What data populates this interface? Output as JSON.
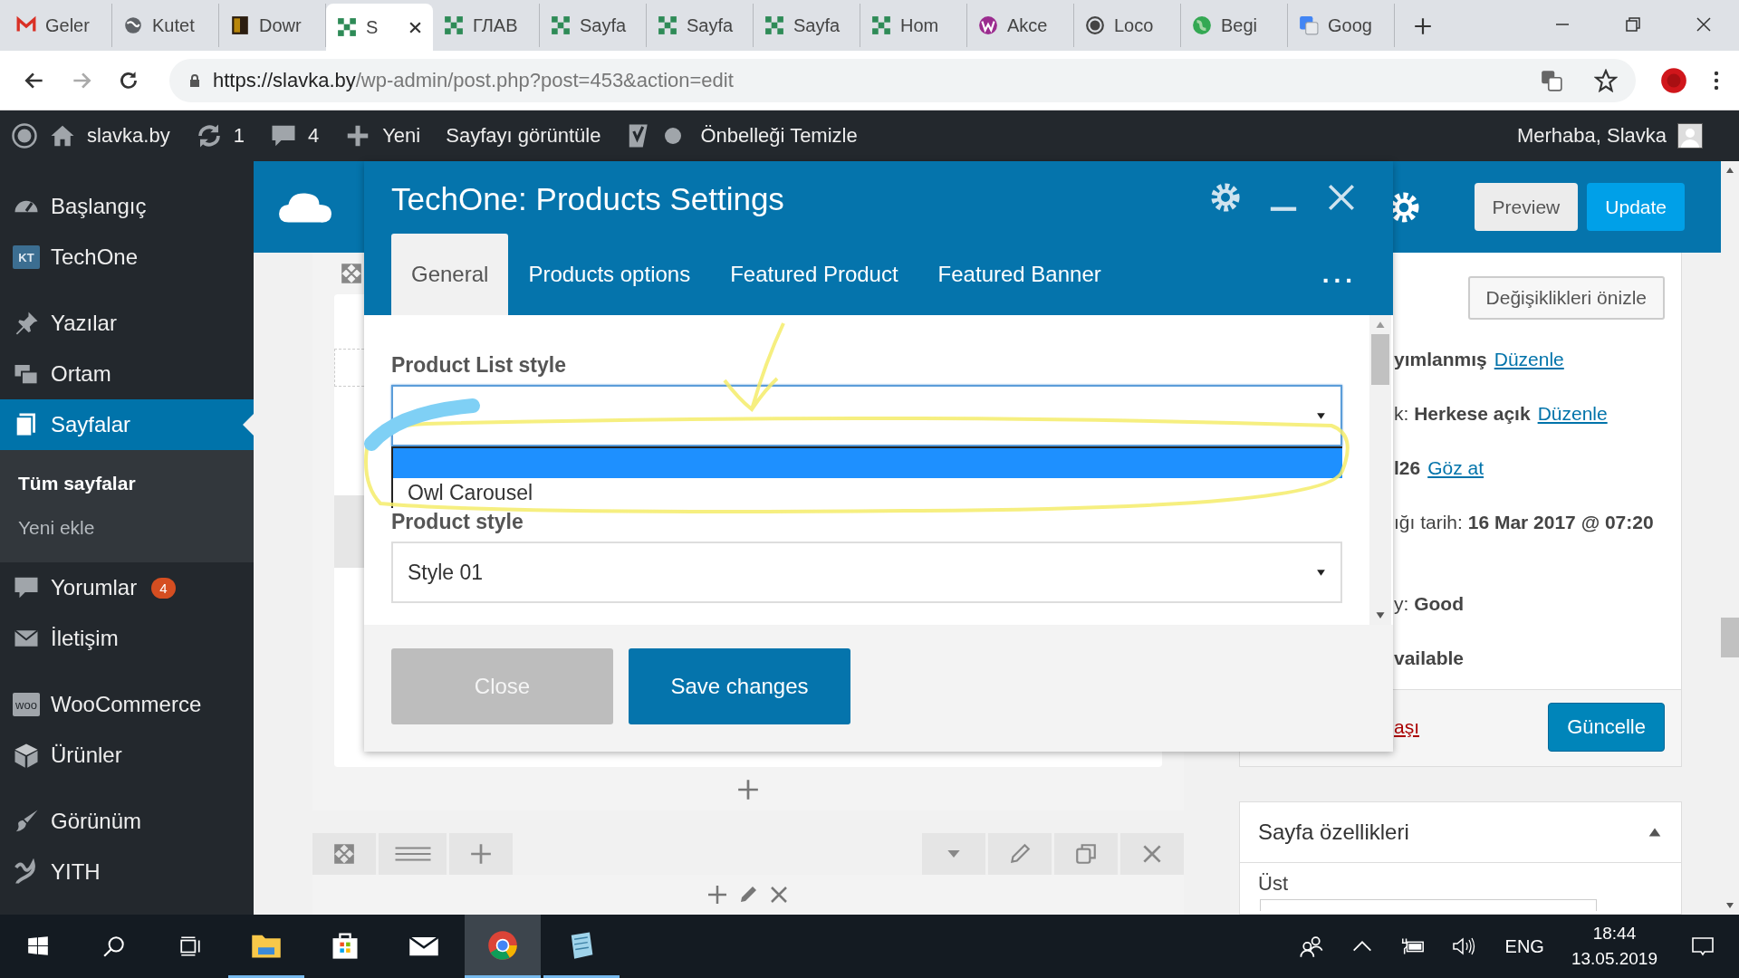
{
  "browser": {
    "tabs": [
      {
        "label": "Geler",
        "kind": "gmail",
        "selected": false
      },
      {
        "label": "Kutet",
        "kind": "globe",
        "selected": false
      },
      {
        "label": "Dowr",
        "kind": "book",
        "selected": false
      },
      {
        "label": "S",
        "kind": "grid",
        "selected": true
      },
      {
        "label": "ГЛАВ",
        "kind": "grid",
        "selected": false
      },
      {
        "label": "Sayfa",
        "kind": "grid",
        "selected": false
      },
      {
        "label": "Sayfa",
        "kind": "grid",
        "selected": false
      },
      {
        "label": "Sayfa",
        "kind": "grid",
        "selected": false
      },
      {
        "label": "Hom",
        "kind": "grid",
        "selected": false
      },
      {
        "label": "Akce",
        "kind": "w",
        "selected": false
      },
      {
        "label": "Loco",
        "kind": "wordpress",
        "selected": false
      },
      {
        "label": "Begi",
        "kind": "earth",
        "selected": false
      },
      {
        "label": "Goog",
        "kind": "translate",
        "selected": false
      }
    ],
    "url_host": "https://slavka.by",
    "url_path": "/wp-admin/post.php?post=453&action=edit"
  },
  "admin_bar": {
    "site": "slavka.by",
    "updates": "1",
    "comments": "4",
    "new": "Yeni",
    "view": "Sayfayı görüntüle",
    "cache": "Önbelleği Temizle",
    "greeting": "Merhaba, Slavka"
  },
  "sidebar": {
    "groups": [
      [
        {
          "label": "Başlangıç",
          "kind": "dashboard",
          "selected": false
        },
        {
          "label": "TechOne",
          "kind": "kt",
          "icon_text": "KT",
          "selected": false
        }
      ],
      [
        {
          "label": "Yazılar",
          "kind": "pin",
          "selected": false
        },
        {
          "label": "Ortam",
          "kind": "media",
          "selected": false
        },
        {
          "label": "Sayfalar",
          "kind": "pages",
          "selected": true,
          "children": [
            {
              "label": "Tüm sayfalar",
              "selected": true
            },
            {
              "label": "Yeni ekle",
              "selected": false
            }
          ]
        },
        {
          "label": "Yorumlar",
          "kind": "comment",
          "badge": "4",
          "selected": false
        },
        {
          "label": "İletişim",
          "kind": "mail",
          "selected": false
        }
      ],
      [
        {
          "label": "WooCommerce",
          "kind": "woo",
          "icon_text": "woo",
          "selected": false
        },
        {
          "label": "Ürünler",
          "kind": "box",
          "selected": false
        }
      ],
      [
        {
          "label": "Görünüm",
          "kind": "brush",
          "selected": false
        },
        {
          "label": "YITH",
          "kind": "yith",
          "selected": false
        }
      ]
    ]
  },
  "editor": {
    "preview": "Preview",
    "update": "Update"
  },
  "publish_box": {
    "preview_changes": "Değişiklikleri önizle",
    "rows": [
      {
        "text": "**yımlanmış**",
        "link": "Düzenle"
      },
      {
        "text": "k: **Herkese açık**",
        "link": "Düzenle"
      },
      {
        "text": "**l26**",
        "link": "Göz at"
      },
      {
        "text": "ığı tarih: **16 Mar 2017 @ 07:20**"
      },
      {
        "text": "y: **Good**"
      },
      {
        "text": "**vailable**"
      }
    ],
    "trash": "aşı",
    "update": "Güncelle"
  },
  "page_attributes": {
    "title": "Sayfa özellikleri",
    "expanded": true,
    "parent_label": "Üst"
  },
  "modal": {
    "title": "TechOne: Products Settings",
    "tabs": [
      {
        "label": "General",
        "selected": true
      },
      {
        "label": "Products options",
        "selected": false
      },
      {
        "label": "Featured Product",
        "selected": false
      },
      {
        "label": "Featured Banner",
        "selected": false
      }
    ],
    "more": "...",
    "fields": [
      {
        "label": "Product List style",
        "open": true,
        "options": [
          {
            "selected": true
          },
          {
            "label": "Owl Carousel",
            "selected": false
          }
        ]
      },
      {
        "label": "Product style",
        "value": "Style 01",
        "open": false
      }
    ],
    "close": "Close",
    "save": "Save changes"
  },
  "taskbar": {
    "apps": [
      {
        "kind": "explorer",
        "running": true,
        "selected": false
      },
      {
        "kind": "store",
        "running": false,
        "selected": false
      },
      {
        "kind": "mail",
        "running": false,
        "selected": false
      },
      {
        "kind": "chrome",
        "running": true,
        "selected": true
      },
      {
        "kind": "notepad",
        "running": true,
        "selected": false
      }
    ],
    "language": "ENG",
    "time": "18:44",
    "date": "13.05.2019"
  }
}
